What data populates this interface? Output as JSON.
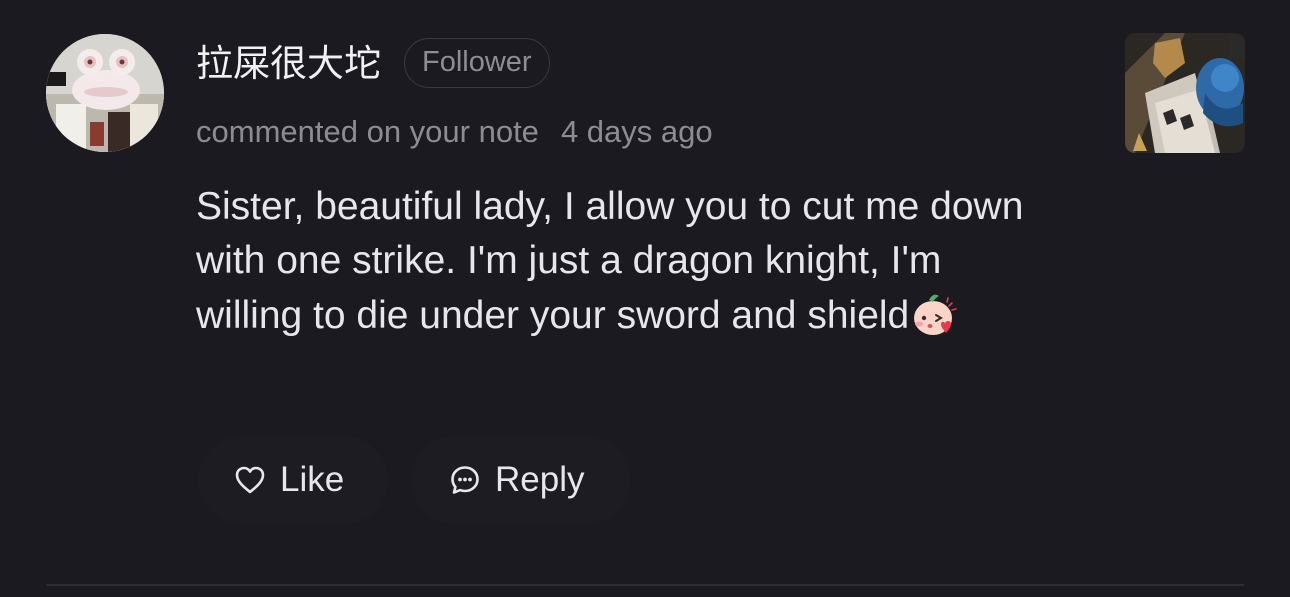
{
  "comment": {
    "username": "拉屎很大坨",
    "badge": "Follower",
    "action": "commented on your note",
    "time": "4 days ago",
    "text": "Sister, beautiful lady, I allow you to cut me down with one strike. I'm just a dragon knight, I'm willing to die under your sword and shield",
    "text_emoji": "blowing-kiss-baby-emoji",
    "avatar_icon": "frog-avatar",
    "thumbnail_icon": "note-thumbnail"
  },
  "actions": {
    "like_label": "Like",
    "like_icon": "heart-icon",
    "reply_label": "Reply",
    "reply_icon": "chat-bubble-icon"
  },
  "colors": {
    "background": "#1b1a20",
    "primary_text": "#e6e6eb",
    "secondary_text": "#8d8c94",
    "badge_border": "#3a3940"
  }
}
